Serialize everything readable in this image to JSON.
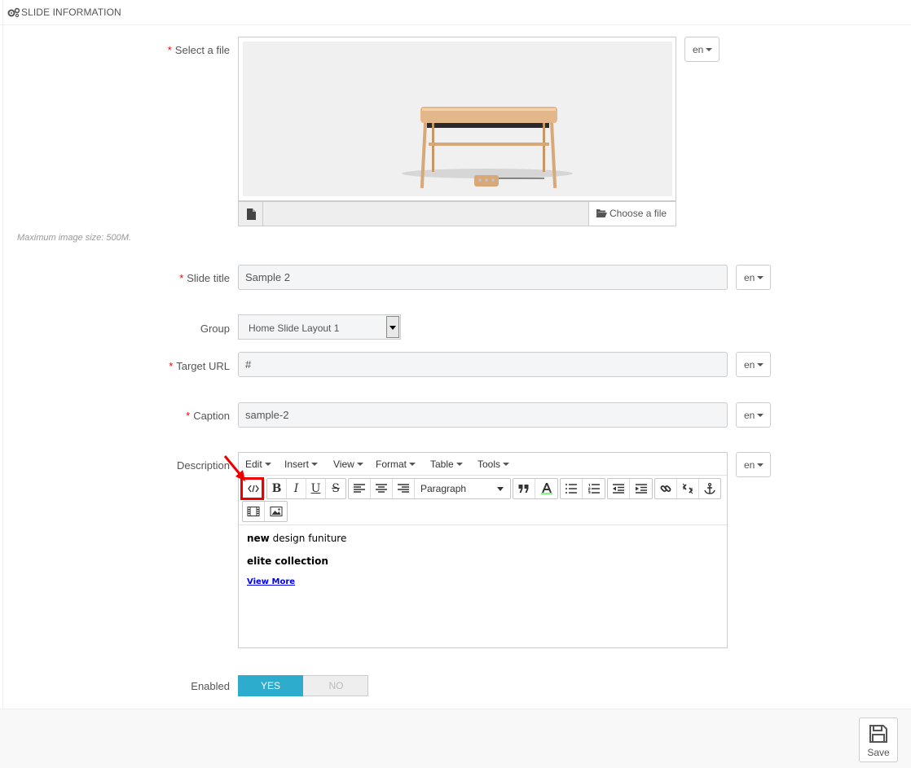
{
  "panel": {
    "title": "SLIDE INFORMATION"
  },
  "fields": {
    "file": {
      "label": "Select a file",
      "choose_label": "Choose a file",
      "help": "Maximum image size: 500M.",
      "lang": "en"
    },
    "slide_title": {
      "label": "Slide title",
      "value": "Sample 2",
      "lang": "en"
    },
    "group": {
      "label": "Group",
      "value": "Home Slide Layout 1"
    },
    "target_url": {
      "label": "Target URL",
      "value": "#",
      "lang": "en"
    },
    "caption": {
      "label": "Caption",
      "value": "sample-2",
      "lang": "en"
    },
    "description": {
      "label": "Description",
      "lang": "en",
      "menus": [
        "Edit",
        "Insert",
        "View",
        "Format",
        "Table",
        "Tools"
      ],
      "format_select": "Paragraph",
      "content": {
        "line1_bold": "new",
        "line1_rest": " design funiture",
        "line2": "elite collection",
        "link": "View More"
      }
    },
    "enabled": {
      "label": "Enabled",
      "yes": "YES",
      "no": "NO",
      "value": "YES"
    }
  },
  "required_marker": "*",
  "footer": {
    "save_label": "Save"
  },
  "icons": [
    "gears-icon",
    "file-icon",
    "folder-open-icon",
    "code-icon",
    "bold-icon",
    "italic-icon",
    "underline-icon",
    "strikethrough-icon",
    "align-left-icon",
    "align-center-icon",
    "align-right-icon",
    "blockquote-icon",
    "text-color-icon",
    "bullet-list-icon",
    "numbered-list-icon",
    "outdent-icon",
    "indent-icon",
    "link-icon",
    "unlink-icon",
    "anchor-icon",
    "video-icon",
    "image-icon",
    "save-icon"
  ],
  "colors": {
    "accent": "#2eacce",
    "required": "#e00000",
    "highlight": "#e00000"
  }
}
